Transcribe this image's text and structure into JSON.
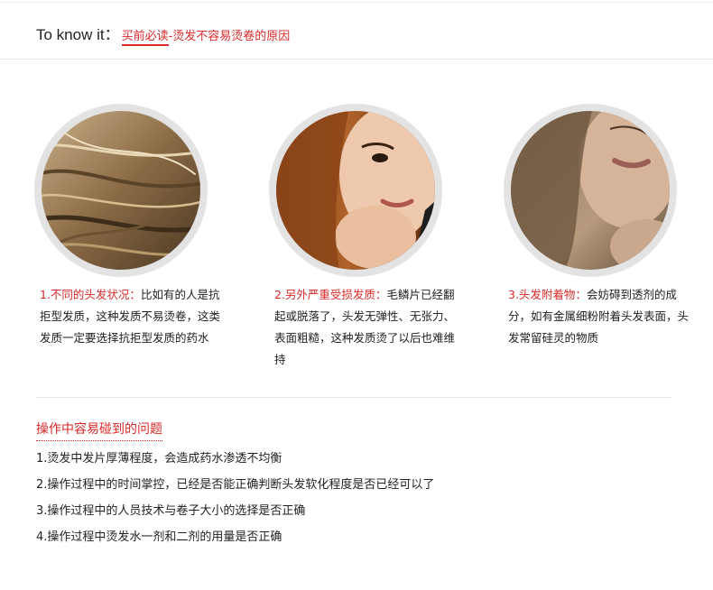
{
  "header": {
    "title": "To know it：",
    "link_part1": "买前必读",
    "link_part2": "-烫发不容易烫卷的原因"
  },
  "cards": [
    {
      "image_icon": "hair-closeup-photo",
      "lead": "1.不同的头发状况：",
      "text": "比如有的人是抗拒型发质，这种发质不易烫卷，这类发质一定要选择抗拒型发质的药水"
    },
    {
      "image_icon": "woman-portrait-photo",
      "lead": "2.另外严重受损发质：",
      "text": "毛鳞片已经翻起或脱落了，头发无弹性、无张力、表面粗糙，这种发质烫了以后也难维持"
    },
    {
      "image_icon": "woman-face-photo",
      "lead": "3.头发附着物：",
      "text": "会妨碍到透剂的成分，如有金属细粉附着头发表面，头发常留硅灵的物质"
    }
  ],
  "issues": {
    "title": "操作中容易碰到的问题",
    "items": [
      "1.烫发中发片厚薄程度，会造成药水渗透不均衡",
      "2.操作过程中的时间掌控，已经是否能正确判断头发软化程度是否已经可以了",
      "3.操作过程中的人员技术与卷子大小的选择是否正确",
      "4.操作过程中烫发水一剂和二剂的用量是否正确"
    ]
  },
  "colors": {
    "accent": "#d92a2a",
    "circle_ring": "#e3e3e3",
    "divider": "#e6e6e6"
  }
}
